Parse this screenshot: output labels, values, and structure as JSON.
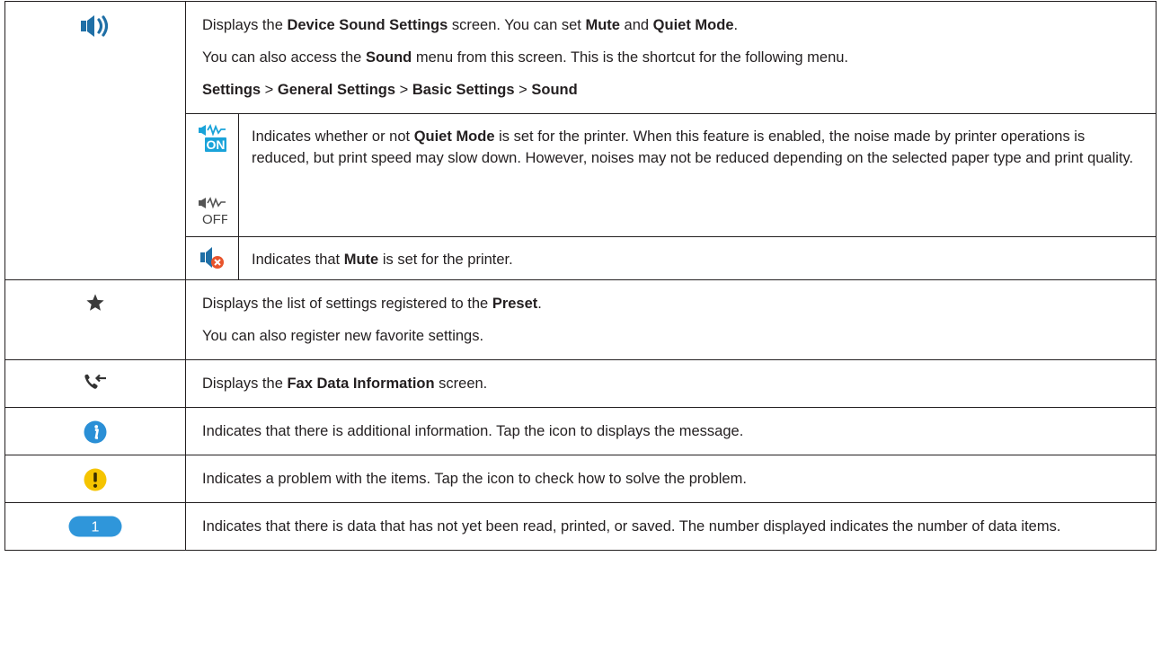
{
  "rows": [
    {
      "icon": "speaker-icon",
      "paragraphs": [
        [
          "Displays the ",
          {
            "b": "Device Sound Settings"
          },
          " screen. You can set ",
          {
            "b": "Mute"
          },
          " and ",
          {
            "b": "Quiet Mode"
          },
          "."
        ],
        [
          "You can also access the ",
          {
            "b": "Sound"
          },
          " menu from this screen. This is the shortcut for the following menu."
        ],
        [
          {
            "b": "Settings"
          },
          " > ",
          {
            "b": "General Settings"
          },
          " > ",
          {
            "b": "Basic Settings"
          },
          " > ",
          {
            "b": "Sound"
          }
        ]
      ],
      "subrows": [
        {
          "icons": [
            "quiet-mode-on-icon",
            "quiet-mode-off-icon"
          ],
          "icon_labels": [
            "ON",
            "OFF"
          ],
          "paragraphs": [
            [
              "Indicates whether or not ",
              {
                "b": "Quiet Mode"
              },
              " is set for the printer. When this feature is enabled, the noise made by printer operations is reduced, but print speed may slow down. However, noises may not be reduced depending on the selected paper type and print quality."
            ]
          ]
        },
        {
          "icons": [
            "mute-icon"
          ],
          "icon_labels": [],
          "paragraphs": [
            [
              "Indicates that ",
              {
                "b": "Mute"
              },
              " is set for the printer."
            ]
          ]
        }
      ]
    },
    {
      "icon": "star-icon",
      "paragraphs": [
        [
          "Displays the list of settings registered to the ",
          {
            "b": "Preset"
          },
          "."
        ],
        [
          "You can also register new favorite settings."
        ]
      ]
    },
    {
      "icon": "fax-data-icon",
      "paragraphs": [
        [
          "Displays the ",
          {
            "b": "Fax Data Information"
          },
          " screen."
        ]
      ]
    },
    {
      "icon": "info-icon",
      "paragraphs": [
        [
          "Indicates that there is additional information. Tap the icon to displays the message."
        ]
      ]
    },
    {
      "icon": "warning-icon",
      "paragraphs": [
        [
          "Indicates a problem with the items. Tap the icon to check how to solve the problem."
        ]
      ]
    },
    {
      "icon": "unread-count-badge-icon",
      "badge_number": "1",
      "paragraphs": [
        [
          "Indicates that there is data that has not yet been read, printed, or saved. The number displayed indicates the number of data items."
        ]
      ]
    }
  ],
  "colors": {
    "text": "#231f20",
    "border": "#231f20",
    "icon_blue": "#1f6fa6",
    "icon_cyan": "#1aa3d9",
    "info_blue": "#2a8fd6",
    "warning_yellow": "#f5c400",
    "mute_red": "#e8542c",
    "star_dark": "#3a3a3a"
  }
}
